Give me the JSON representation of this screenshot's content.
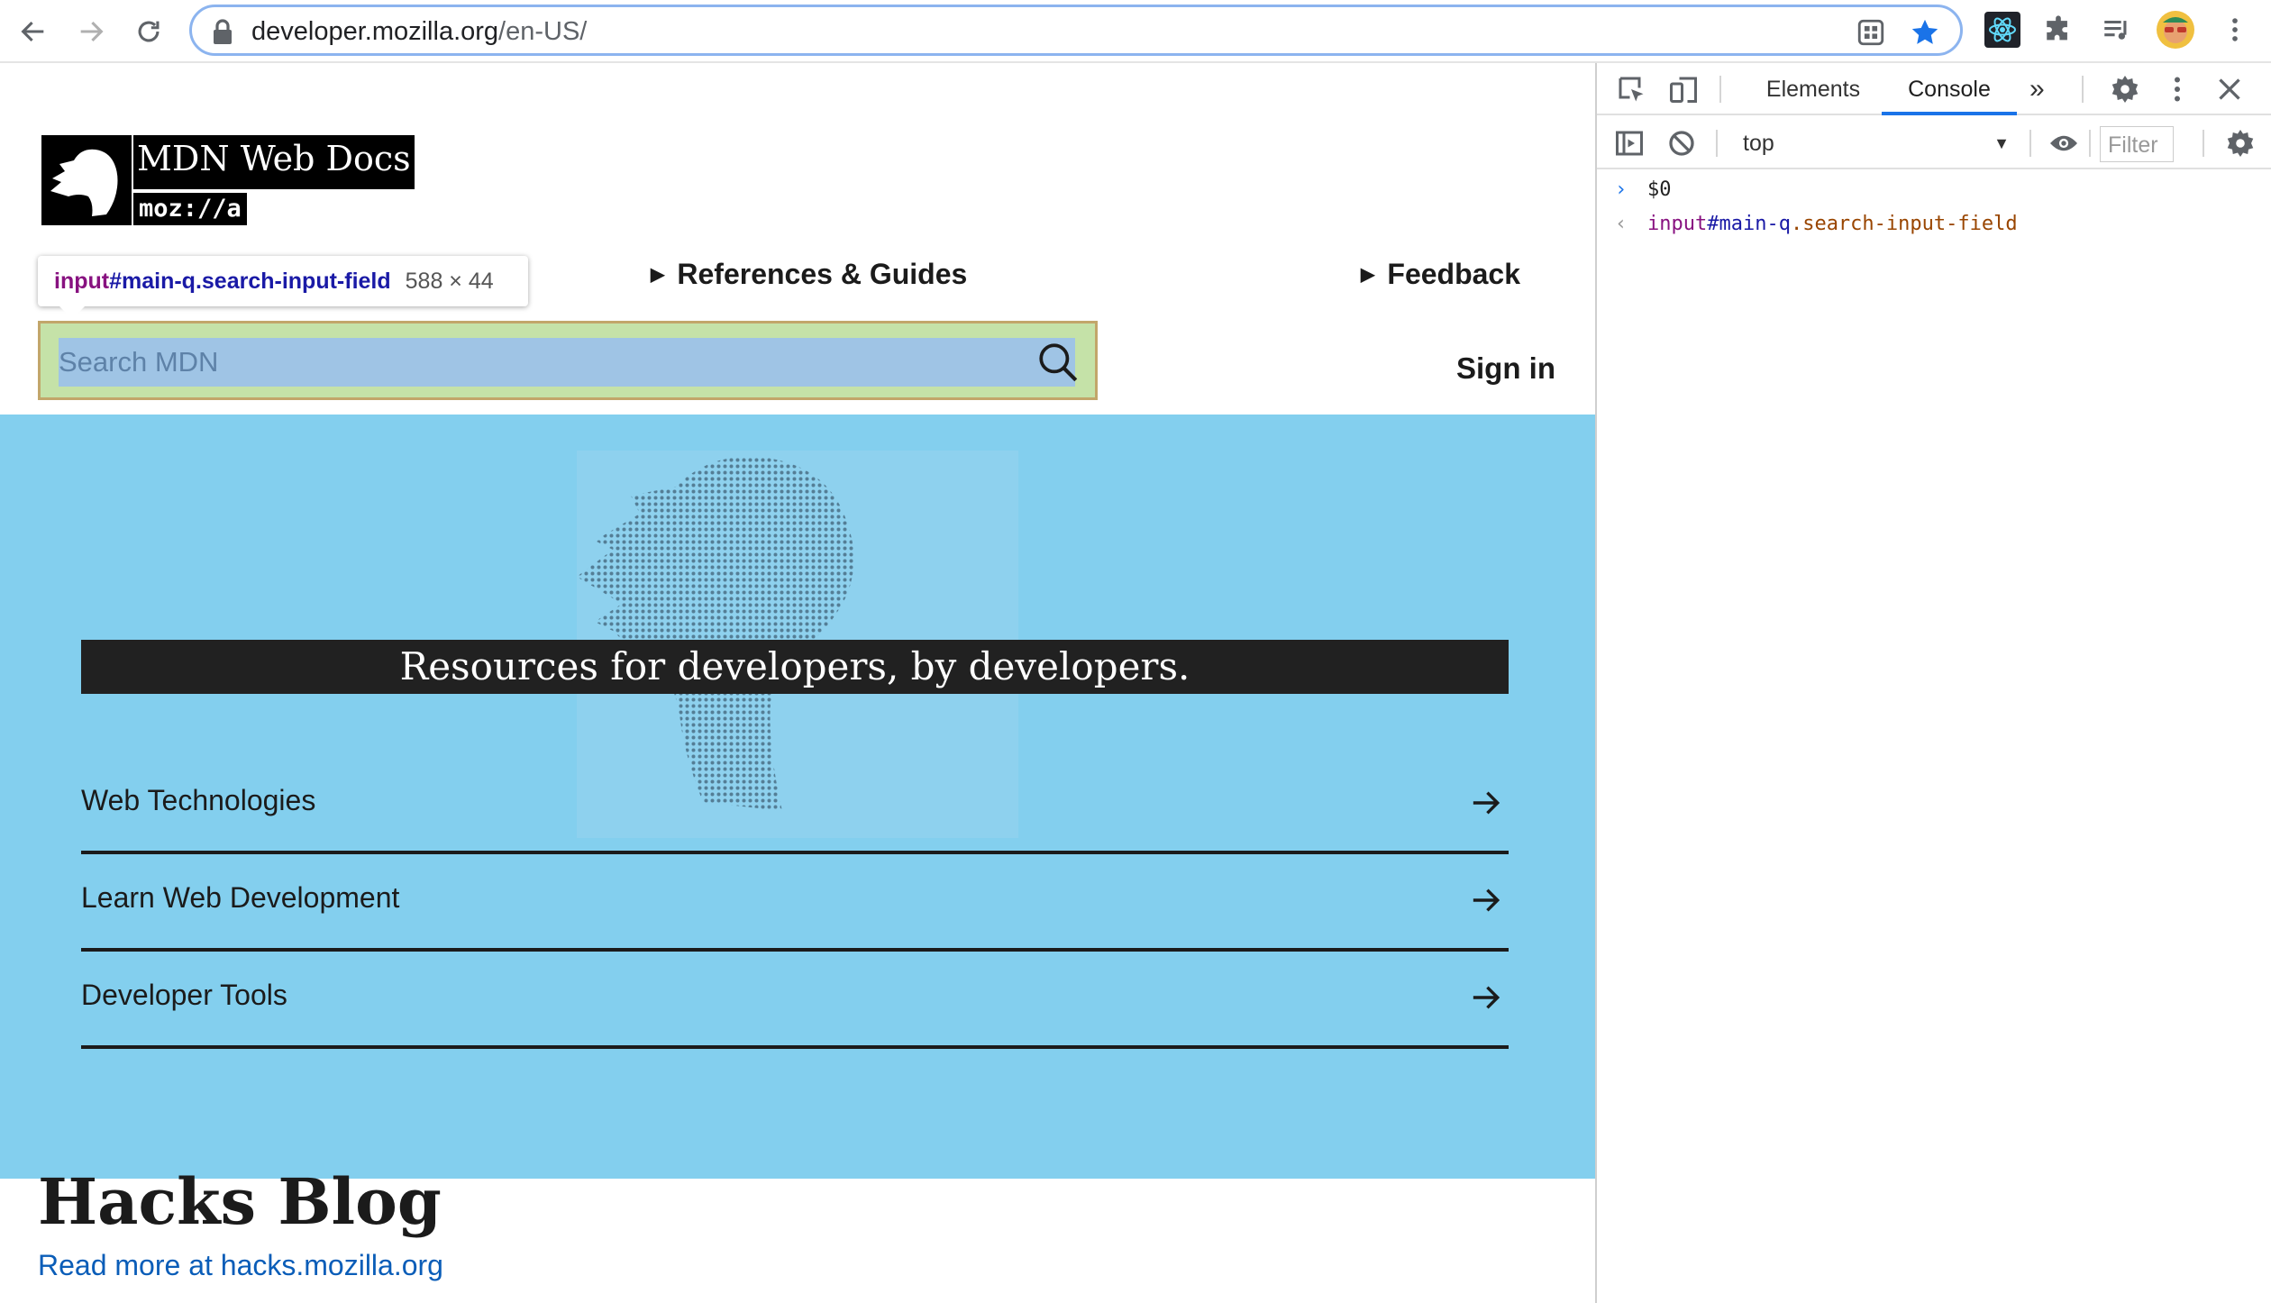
{
  "browser": {
    "url_host": "developer.mozilla.org",
    "url_path": "/en-US/"
  },
  "page": {
    "logo": {
      "title": "MDN Web Docs",
      "sub": "moz://a"
    },
    "tooltip": {
      "tag": "input",
      "id": "#main-q",
      "cls": ".search-input-field",
      "size": "588 × 44"
    },
    "nav": {
      "references": "References & Guides",
      "feedback": "Feedback",
      "signin": "Sign in"
    },
    "search": {
      "placeholder": "Search MDN"
    },
    "hero": {
      "banner": "Resources for developers, by developers.",
      "links": [
        {
          "label": "Web Technologies"
        },
        {
          "label": "Learn Web Development"
        },
        {
          "label": "Developer Tools"
        }
      ]
    },
    "blog": {
      "title": "Hacks Blog",
      "link": "Read more at hacks.mozilla.org"
    }
  },
  "devtools": {
    "tabs": {
      "elements": "Elements",
      "console": "Console",
      "more": "»"
    },
    "context": "top",
    "filter_placeholder": "Filter",
    "console": {
      "input": "$0",
      "output_tag": "input",
      "output_id": "#main-q",
      "output_cls": ".search-input-field"
    }
  },
  "colors": {
    "hero_bg": "#83cfee",
    "highlight_padding": "#c5e2a8",
    "highlight_content": "#9fc4e5",
    "link": "#0a5db8",
    "devtools_active": "#1a73e8"
  }
}
